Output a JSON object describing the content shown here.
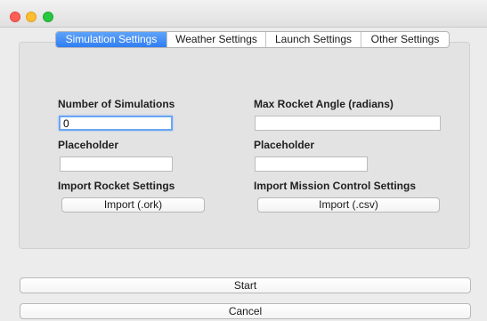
{
  "tabs": [
    {
      "label": "Simulation Settings",
      "active": true
    },
    {
      "label": "Weather Settings",
      "active": false
    },
    {
      "label": "Launch Settings",
      "active": false
    },
    {
      "label": "Other Settings",
      "active": false
    }
  ],
  "form": {
    "num_simulations": {
      "label": "Number of Simulations",
      "value": "0"
    },
    "max_rocket_angle": {
      "label": "Max Rocket Angle (radians)",
      "value": ""
    },
    "placeholder_left": {
      "label": "Placeholder",
      "value": ""
    },
    "placeholder_right": {
      "label": "Placeholder",
      "value": ""
    },
    "import_rocket": {
      "label": "Import Rocket Settings",
      "button": "Import (.ork)"
    },
    "import_mission": {
      "label": "Import Mission Control Settings",
      "button": "Import (.csv)"
    }
  },
  "actions": {
    "start": "Start",
    "cancel": "Cancel"
  },
  "colors": {
    "active_tab": "#2f7ef4",
    "close": "#fd5f57",
    "minimize": "#fdbd2e",
    "maximize": "#27c840"
  }
}
